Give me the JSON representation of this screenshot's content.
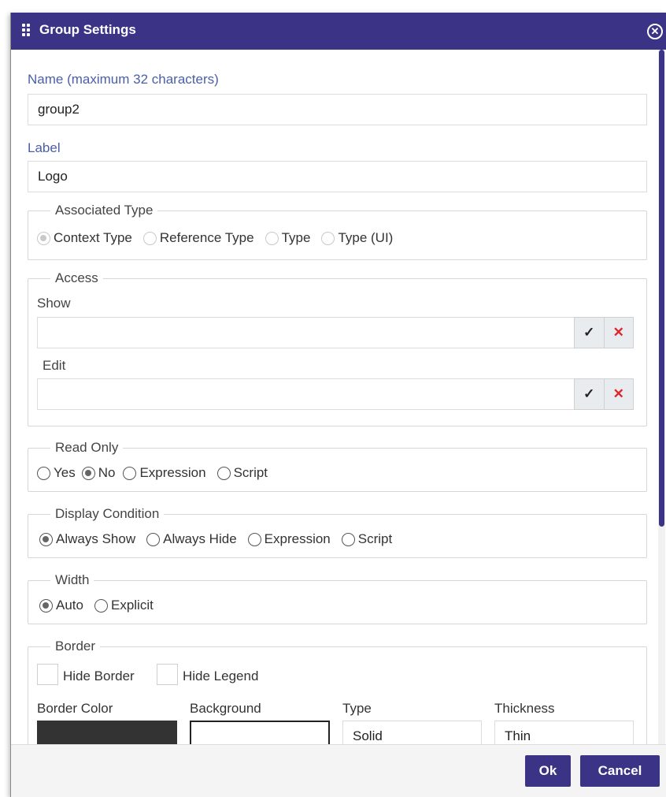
{
  "dialog": {
    "title": "Group Settings",
    "accent_color": "#3b3486"
  },
  "name": {
    "label": "Name (maximum 32 characters)",
    "value": "group2"
  },
  "label_field": {
    "label": "Label",
    "value": "Logo"
  },
  "associated_type": {
    "legend": "Associated Type",
    "options": [
      "Context Type",
      "Reference Type",
      "Type",
      "Type (UI)"
    ],
    "selected": "Context Type",
    "disabled": true
  },
  "access": {
    "legend": "Access",
    "show_label": "Show",
    "show_value": "",
    "edit_label": "Edit",
    "edit_value": "",
    "confirm_icon": "✓",
    "clear_icon": "✕"
  },
  "read_only": {
    "legend": "Read Only",
    "options": [
      "Yes",
      "No",
      "Expression",
      "Script"
    ],
    "selected": "No"
  },
  "display_condition": {
    "legend": "Display Condition",
    "options": [
      "Always Show",
      "Always Hide",
      "Expression",
      "Script"
    ],
    "selected": "Always Show"
  },
  "width": {
    "legend": "Width",
    "options": [
      "Auto",
      "Explicit"
    ],
    "selected": "Auto"
  },
  "border": {
    "legend": "Border",
    "hide_border_label": "Hide Border",
    "hide_legend_label": "Hide Legend",
    "border_color_label": "Border Color",
    "border_color": "#333333",
    "background_label": "Background",
    "background_color": "#ffffff",
    "type_label": "Type",
    "type_value": "Solid",
    "thickness_label": "Thickness",
    "thickness_value": "Thin"
  },
  "footer": {
    "ok_label": "Ok",
    "cancel_label": "Cancel"
  }
}
